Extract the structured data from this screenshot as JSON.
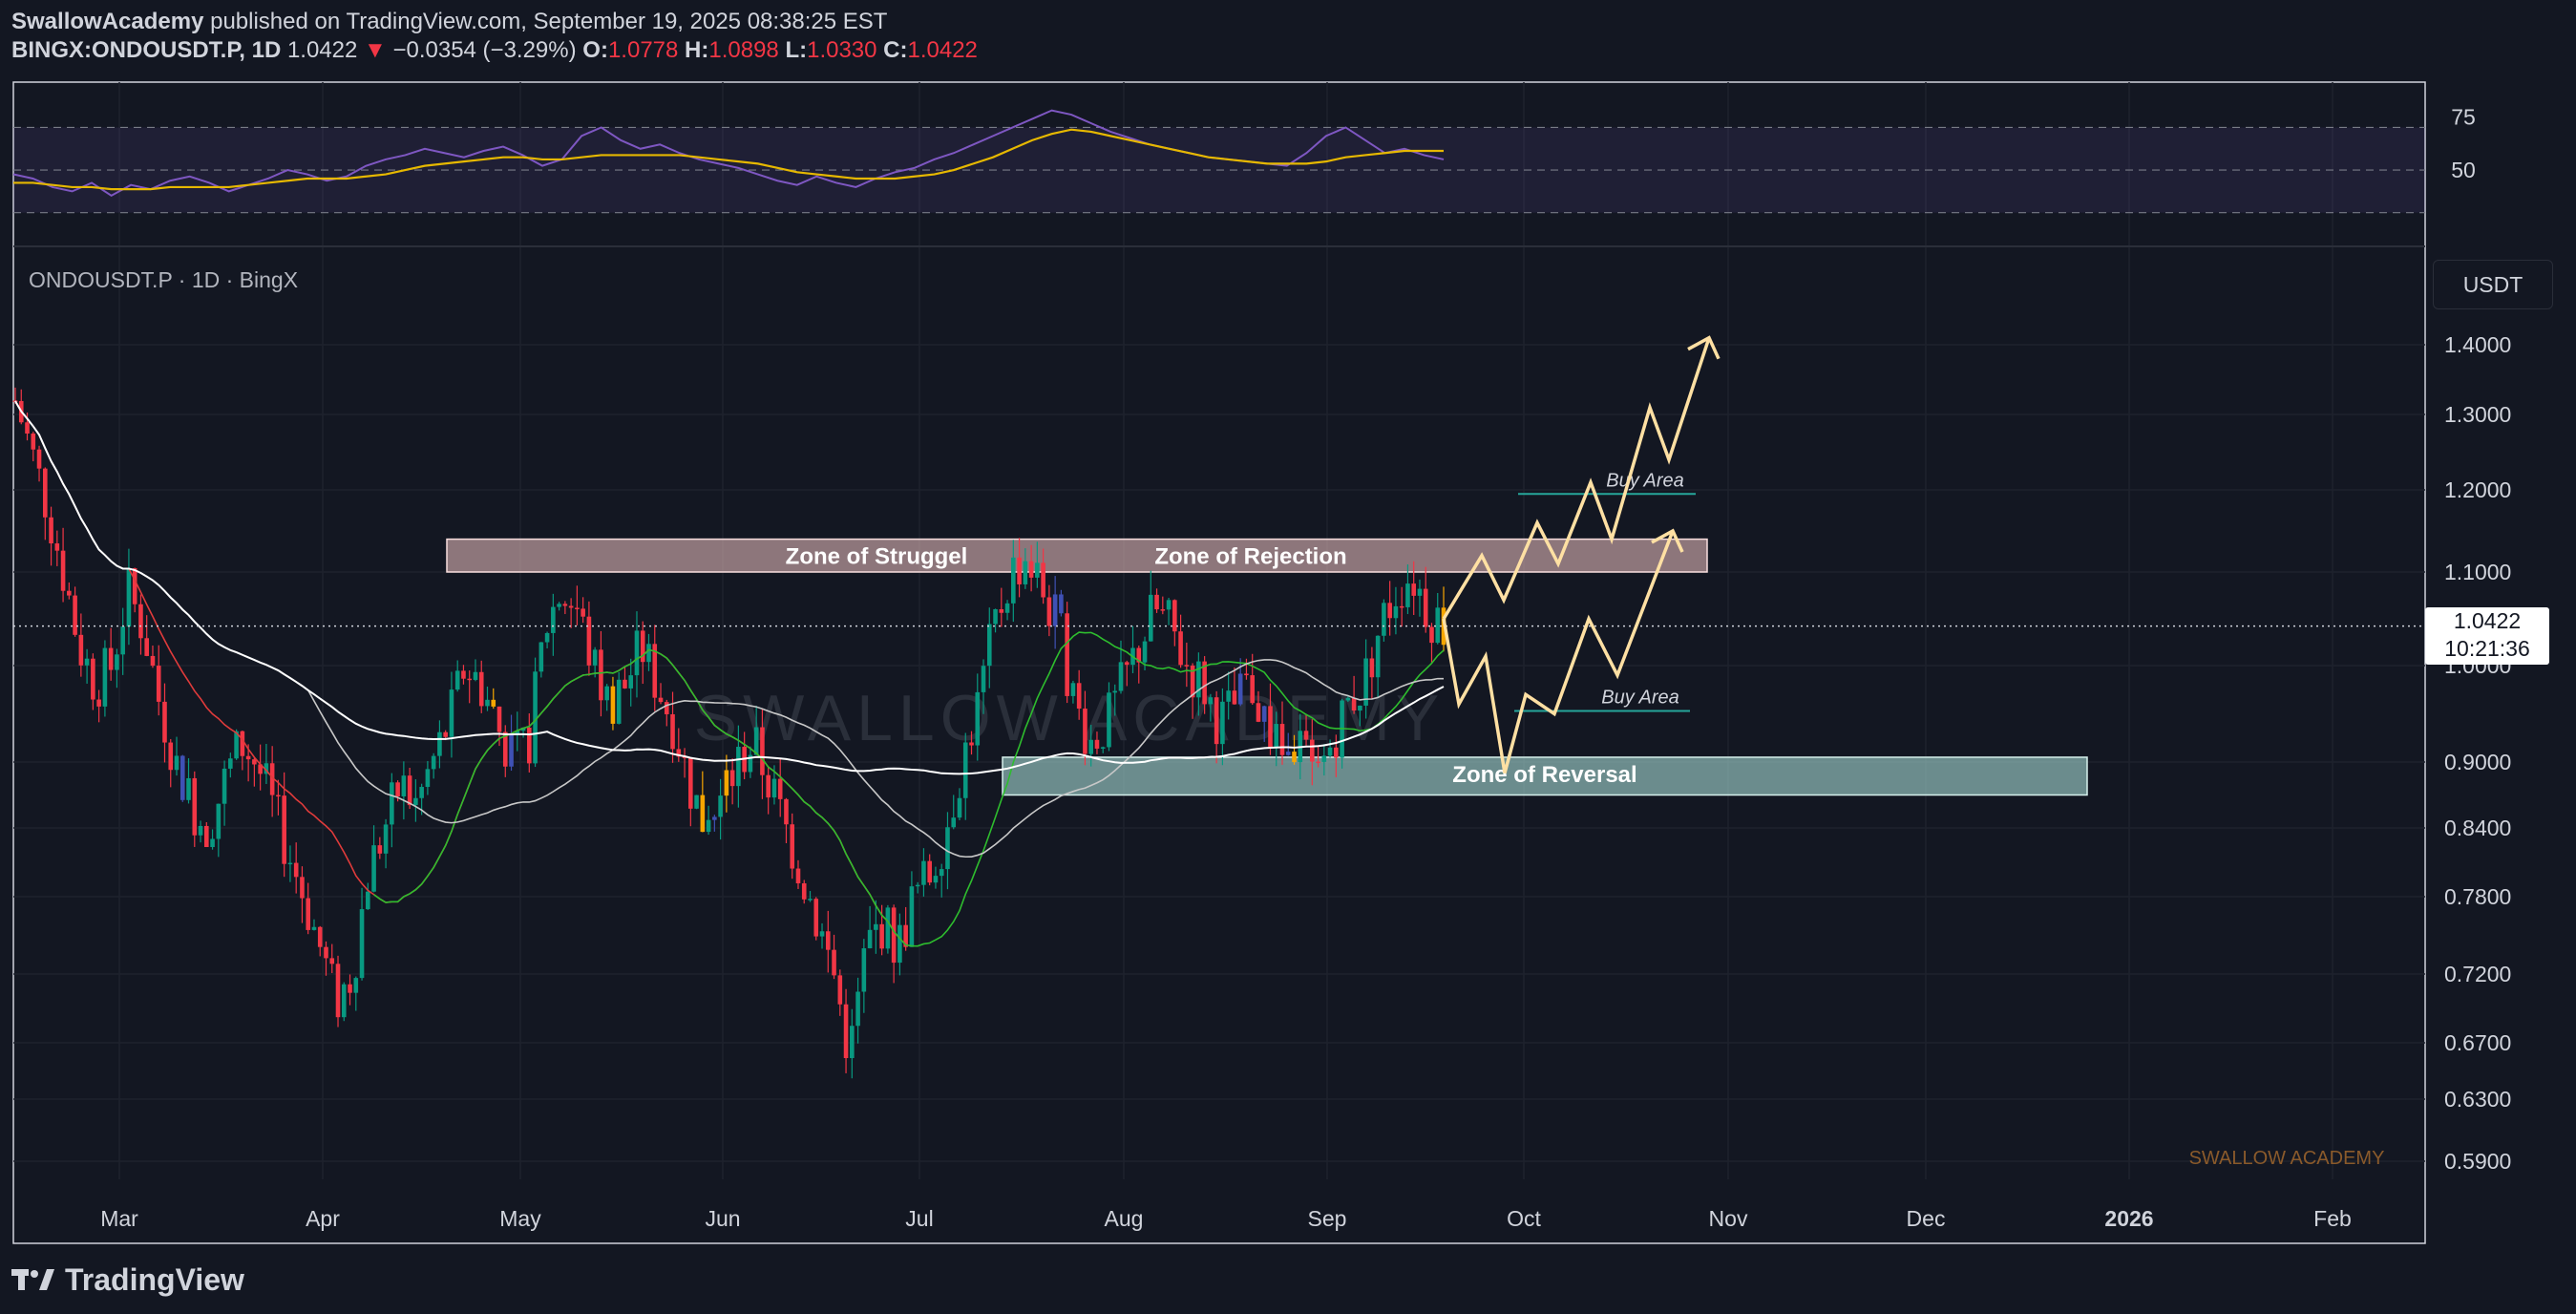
{
  "header": {
    "publisher": "SwallowAcademy",
    "published_text": "published on TradingView.com, September 19, 2025 08:38:25 EST",
    "symbol_line": "BINGX:ONDOUSDT.P, 1D",
    "last": "1.0422",
    "change_arrow": "▼",
    "change": "−0.0354 (−3.29%)",
    "o_label": "O:",
    "o": "1.0778",
    "h_label": "H:",
    "h": "1.0898",
    "l_label": "L:",
    "l": "1.0330",
    "c_label": "C:",
    "c": "1.0422"
  },
  "pane_title": "ONDOUSDT.P · 1D · BingX",
  "currency_button": "USDT",
  "price_tag": {
    "price": "1.0422",
    "countdown": "10:21:36"
  },
  "brand": "TradingView",
  "colors": {
    "background": "#131722",
    "up": "#089981",
    "down": "#f23645",
    "rsi": "#7e57c2",
    "rsi_ma": "#e6b800",
    "arrows": "#ffe0a3",
    "zone_struggle": "#f3c4c4",
    "zone_reversal": "#a7dbd5"
  },
  "chart_data": [
    {
      "type": "line",
      "title": "RSI",
      "y_ticks": [
        "75",
        "50"
      ],
      "bands": [
        70,
        50,
        30
      ],
      "ylim": [
        20,
        85
      ],
      "series": [
        {
          "values": [
            48,
            46,
            42,
            40,
            44,
            38,
            43,
            41,
            45,
            47,
            44,
            40,
            43,
            46,
            50,
            48,
            45,
            47,
            52,
            55,
            57,
            60,
            58,
            56,
            59,
            61,
            57,
            52,
            55,
            66,
            70,
            64,
            60,
            62,
            58,
            55,
            53,
            51,
            48,
            45,
            43,
            47,
            44,
            42,
            46,
            49,
            51,
            55,
            58,
            62,
            66,
            70,
            74,
            78,
            76,
            72,
            68,
            65,
            62,
            60,
            58,
            56,
            55,
            54,
            53,
            52,
            58,
            66,
            70,
            64,
            58,
            60,
            57,
            55
          ],
          "note": ""
        },
        {
          "values": [
            44,
            44,
            43,
            42,
            42,
            41,
            41,
            41,
            42,
            42,
            42,
            42,
            43,
            44,
            45,
            46,
            46,
            46,
            47,
            48,
            50,
            52,
            53,
            54,
            55,
            56,
            56,
            55,
            55,
            56,
            57,
            57,
            57,
            57,
            57,
            56,
            55,
            54,
            53,
            51,
            49,
            48,
            47,
            46,
            46,
            46,
            47,
            48,
            50,
            53,
            56,
            60,
            64,
            67,
            69,
            68,
            66,
            64,
            62,
            60,
            58,
            56,
            55,
            54,
            53,
            53,
            53,
            54,
            56,
            57,
            58,
            59,
            59,
            59
          ]
        }
      ]
    },
    {
      "type": "candlestick",
      "x_ticks": [
        "Mar",
        "Apr",
        "May",
        "Jun",
        "Jul",
        "Aug",
        "Sep",
        "Oct",
        "Nov",
        "Dec",
        "2026",
        "Feb"
      ],
      "y_ticks": [
        "1.4000",
        "1.3000",
        "1.2000",
        "1.1000",
        "1.0000",
        "0.9000",
        "0.8400",
        "0.7800",
        "0.7200",
        "0.6700",
        "0.6300",
        "0.5900"
      ],
      "ylim": [
        0.56,
        1.5
      ],
      "close_path": [
        1.32,
        1.25,
        1.18,
        1.1,
        1.02,
        0.98,
        1.0,
        1.08,
        1.04,
        0.96,
        0.9,
        0.86,
        0.84,
        0.88,
        0.92,
        0.9,
        0.86,
        0.82,
        0.78,
        0.74,
        0.7,
        0.72,
        0.8,
        0.84,
        0.88,
        0.86,
        0.9,
        0.94,
        1.0,
        0.98,
        0.94,
        0.9,
        0.92,
        1.04,
        1.08,
        1.06,
        1.0,
        0.96,
        0.98,
        1.02,
        0.98,
        0.94,
        0.88,
        0.84,
        0.86,
        0.9,
        0.92,
        0.88,
        0.84,
        0.8,
        0.76,
        0.72,
        0.66,
        0.74,
        0.76,
        0.74,
        0.78,
        0.8,
        0.84,
        0.9,
        0.96,
        1.04,
        1.1,
        1.12,
        1.08,
        1.04,
        0.96,
        0.92,
        0.94,
        0.98,
        1.02,
        1.06,
        1.04,
        1.0,
        0.98,
        0.94,
        0.96,
        0.98,
        0.94,
        0.9,
        0.92,
        0.88,
        0.92,
        0.96,
        0.98,
        1.04,
        1.08,
        1.1,
        1.06,
        1.0422
      ],
      "zones": [
        {
          "label": "Zone of Struggel",
          "top": 1.14,
          "bottom": 1.1
        },
        {
          "label": "Zone of Rejection",
          "top": 1.14,
          "bottom": 1.1
        },
        {
          "label": "Zone of Reversal",
          "top": 0.905,
          "bottom": 0.87
        }
      ],
      "buy_areas": [
        {
          "label": "Buy Area",
          "price": 1.195
        },
        {
          "label": "Buy Area",
          "price": 0.953
        }
      ],
      "projection_upper": [
        1.05,
        1.12,
        1.07,
        1.16,
        1.11,
        1.21,
        1.14,
        1.31,
        1.24,
        1.41,
        1.38
      ],
      "projection_lower": [
        1.05,
        0.96,
        1.01,
        0.89,
        0.97,
        0.95,
        1.05,
        0.99,
        1.15,
        1.11
      ],
      "current_price": 1.0422,
      "watermark": "SWALLOW ACADEMY",
      "corner_text": "SWALLOW ACADEMY"
    }
  ]
}
